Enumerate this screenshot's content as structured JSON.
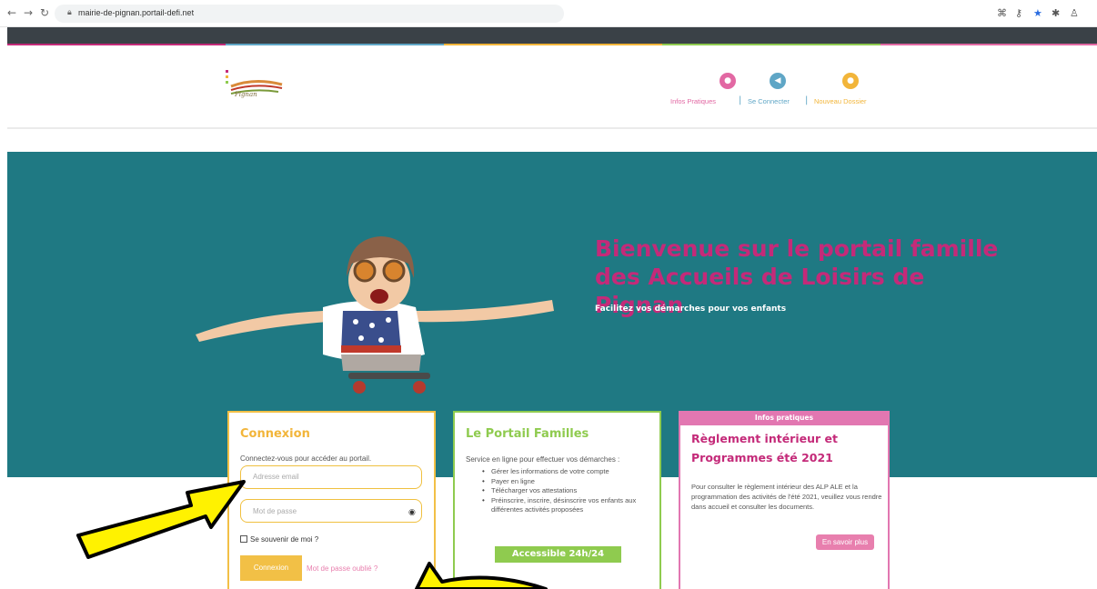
{
  "browser": {
    "url": "mairie-de-pignan.portail-defi.net",
    "icons": [
      "back-icon",
      "forward-icon",
      "reload-icon",
      "lock-icon",
      "extensions-icon",
      "key-icon",
      "bookmark-star-icon",
      "puzzle-icon",
      "profile-icon"
    ]
  },
  "header": {
    "logo_text": "Pignan",
    "nav": [
      {
        "label": "Infos Pratiques",
        "icon": "chat-icon",
        "color": "#e268a3"
      },
      {
        "label": "Se Connecter",
        "icon": "login-icon",
        "color": "#5fa6c6"
      },
      {
        "label": "Nouveau Dossier",
        "icon": "folder-icon",
        "color": "#f2b53a"
      }
    ],
    "separator": "|"
  },
  "hero": {
    "title": "Bienvenue sur le portail famille des Accueils de Loisirs de Pignan",
    "subtitle": "Facilitez vos démarches pour vos enfants",
    "background": "#1f7983",
    "title_color": "#c42a79"
  },
  "login_card": {
    "title": "Connexion",
    "intro": "Connectez-vous pour accéder au portail.",
    "email_placeholder": "Adresse email",
    "password_placeholder": "Mot de passe",
    "remember_label": "Se souvenir de moi ?",
    "submit_label": "Connexion",
    "forgot_label": "Mot de passe oublié ?"
  },
  "portal_card": {
    "title": "Le Portail Familles",
    "intro": "Service en ligne pour effectuer vos démarches :",
    "features": [
      "Gérer les informations de votre compte",
      "Payer en ligne",
      "Télécharger vos attestations",
      "Préinscrire, inscrire, désinscrire vos enfants aux différentes activités proposées"
    ],
    "badge": "Accessible 24h/24"
  },
  "info_card": {
    "band": "Infos pratiques",
    "title": "Règlement intérieur et Programmes été 2021",
    "body": "Pour consulter le règlement intérieur des ALP ALE et la programmation des activités de l'été 2021, veuillez vous rendre dans accueil et consulter les documents.",
    "button": "En savoir plus"
  },
  "colors": {
    "yellow": "#f2c046",
    "green": "#8fcb4f",
    "pink": "#e87fae",
    "arrow": "#fff200"
  }
}
